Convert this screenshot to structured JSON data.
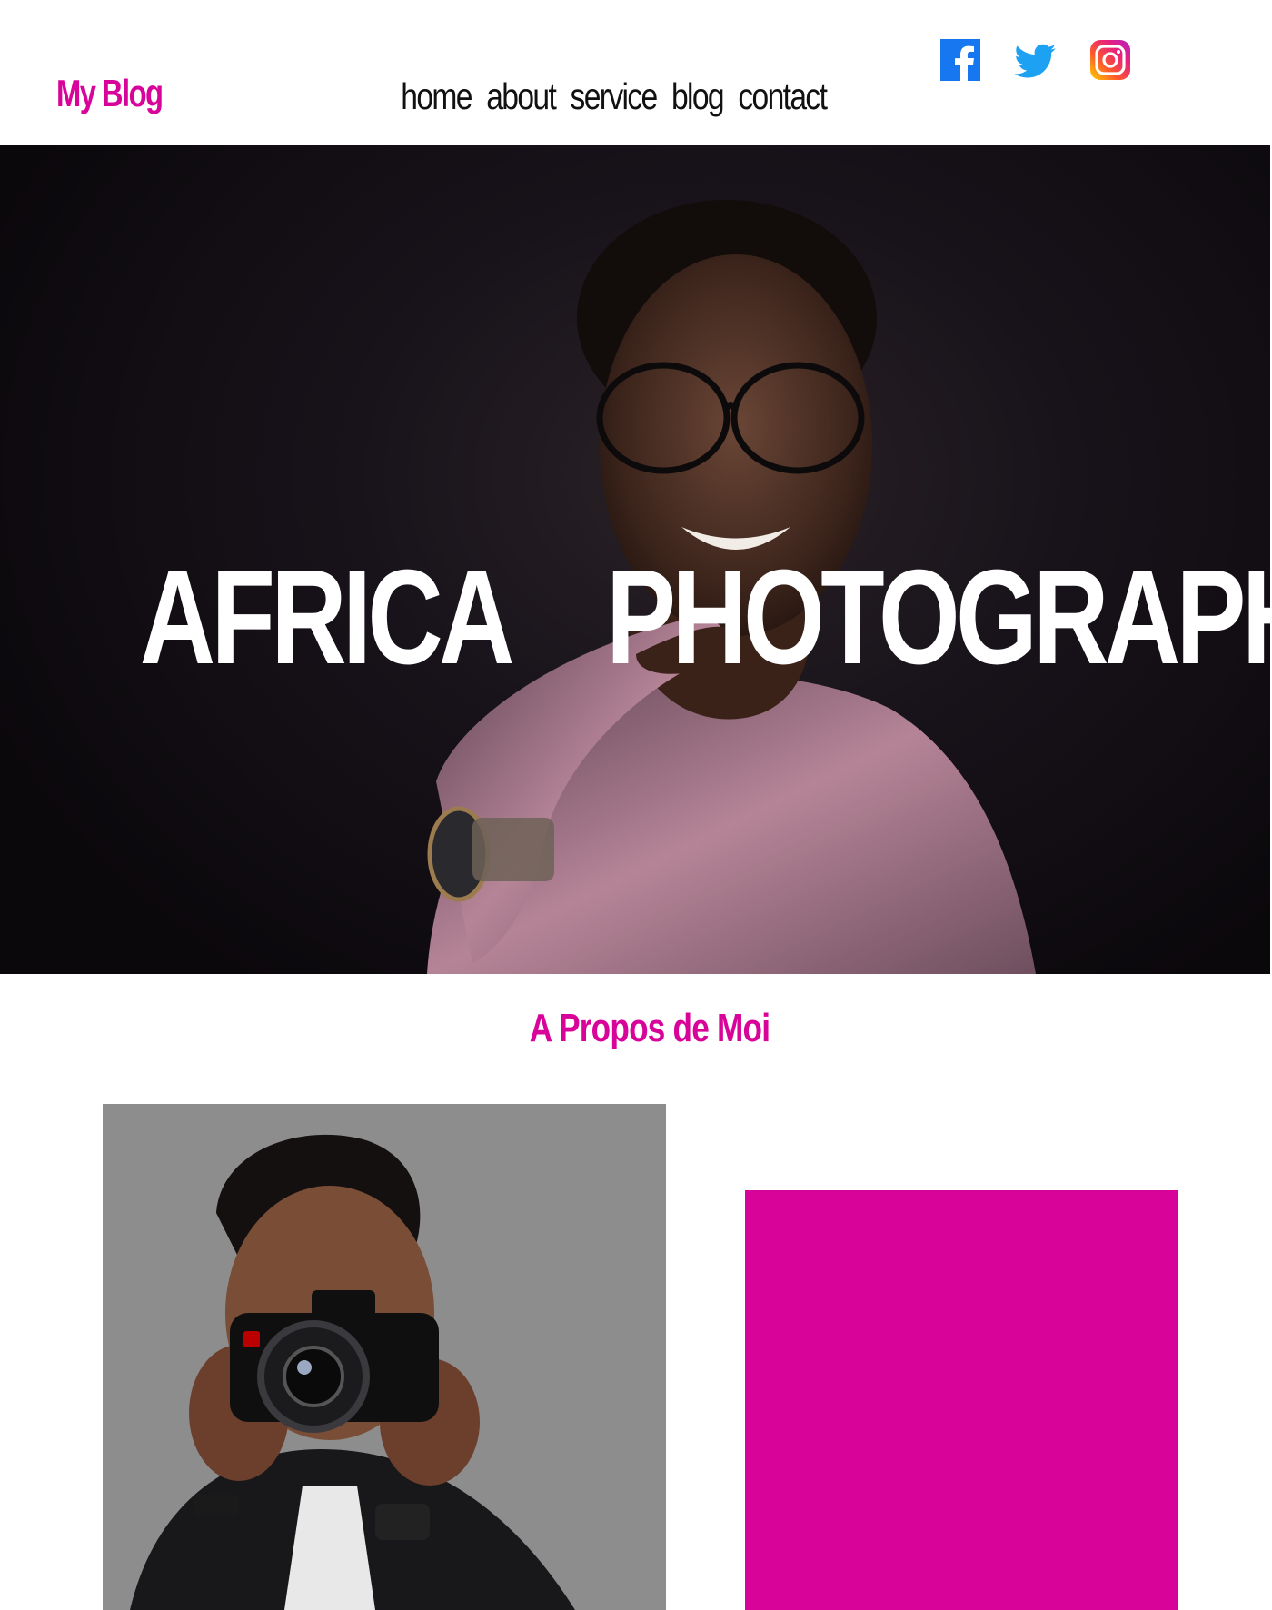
{
  "header": {
    "brand": "My Blog",
    "nav": [
      "home",
      "about",
      "service",
      "blog",
      "contact"
    ],
    "socials": [
      "facebook-icon",
      "twitter-icon",
      "instagram-icon"
    ]
  },
  "hero": {
    "title": "AFRICA    PHOTOGRAPHIE",
    "image": "portrait of smiling woman with glasses in pink top"
  },
  "about": {
    "title": "A Propos de Moi",
    "image": "photographer with camera",
    "block_color": "#d8049a"
  },
  "colors": {
    "accent": "#d8049a",
    "facebook": "#1877f2",
    "twitter": "#1da1f2"
  }
}
